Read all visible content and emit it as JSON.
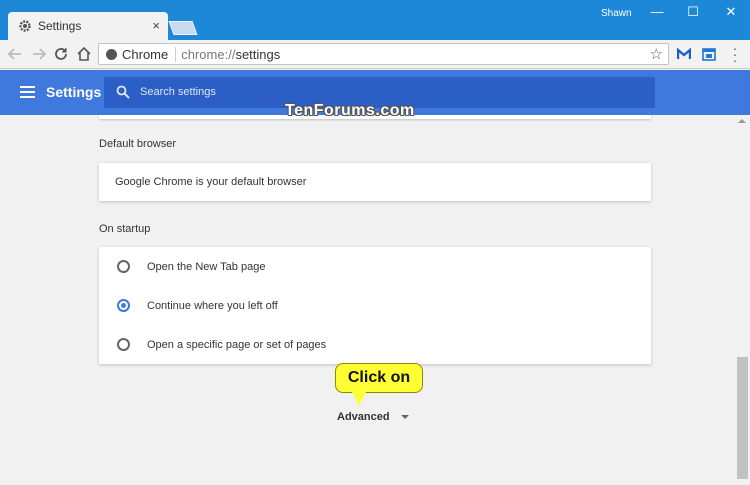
{
  "window": {
    "tab_title": "Settings",
    "tab_close": "×",
    "user_name": "Shawn",
    "minimize": "—",
    "maximize": "☐",
    "close": "✕"
  },
  "toolbar": {
    "site_name": "Chrome",
    "url_scheme": "chrome://",
    "url_path": "settings",
    "star": "☆"
  },
  "settings_header": {
    "title": "Settings",
    "search_placeholder": "Search settings"
  },
  "watermark": "TenForums.com",
  "default_browser": {
    "label": "Default browser",
    "status": "Google Chrome is your default browser"
  },
  "on_startup": {
    "label": "On startup",
    "options": [
      {
        "label": "Open the New Tab page",
        "checked": false
      },
      {
        "label": "Continue where you left off",
        "checked": true
      },
      {
        "label": "Open a specific page or set of pages",
        "checked": false
      }
    ]
  },
  "advanced": {
    "label": "Advanced"
  },
  "callout": {
    "text": "Click on"
  },
  "colors": {
    "titlebar": "#1e88d8",
    "settings_header": "#3f79de",
    "accent": "#3f79de",
    "callout": "#ffff33"
  }
}
